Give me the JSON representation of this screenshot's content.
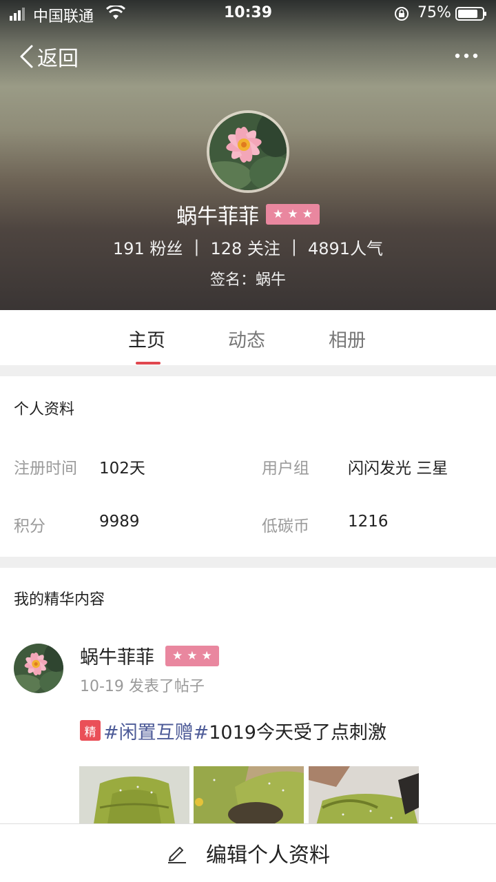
{
  "status_bar": {
    "carrier": "中国联通",
    "time": "10:39",
    "battery_percent": "75%"
  },
  "nav": {
    "back_label": "返回"
  },
  "profile": {
    "name": "蜗牛菲菲",
    "badge_stars": 3,
    "fans": "191 粉丝",
    "following": "128 关注",
    "popularity": "4891人气",
    "separator": "|",
    "signature": "签名：蜗牛"
  },
  "tabs": [
    {
      "label": "主页",
      "active": true
    },
    {
      "label": "动态",
      "active": false
    },
    {
      "label": "相册",
      "active": false
    }
  ],
  "personal_info": {
    "title": "个人资料",
    "register_label": "注册时间",
    "register_value": "102天",
    "group_label": "用户组",
    "group_value": "闪闪发光 三星",
    "points_label": "积分",
    "points_value": "9989",
    "coins_label": "低碳币",
    "coins_value": "1216"
  },
  "featured": {
    "title": "我的精华内容",
    "post": {
      "author": "蜗牛菲菲",
      "meta": "10-19 发表了帖子",
      "badge": "精",
      "topic": "#闲置互赠#",
      "text": "1019今天受了点刺激"
    }
  },
  "bottom_bar": {
    "edit_label": "编辑个人资料"
  },
  "colors": {
    "accent_red": "#e0474f",
    "star_badge_pink": "#e9879f",
    "topic_blue": "#4c5a97",
    "jing_red": "#ea4f58"
  }
}
